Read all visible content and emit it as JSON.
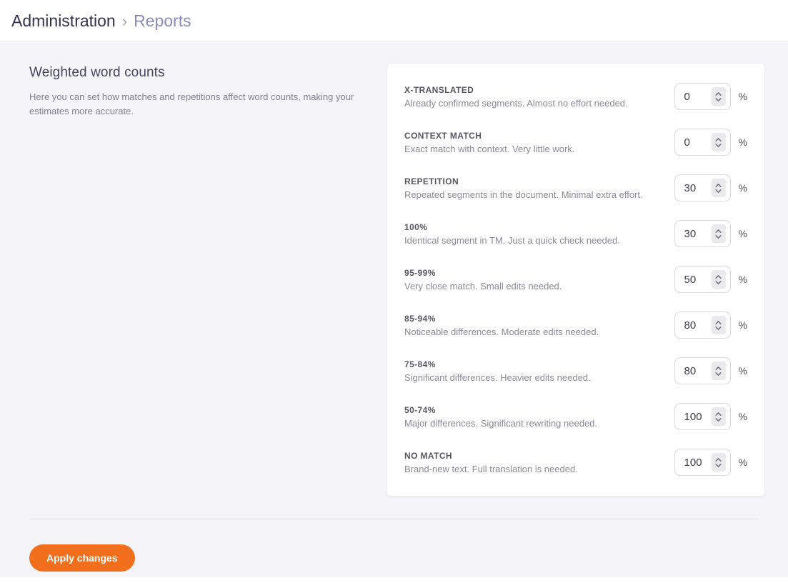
{
  "breadcrumb": {
    "section": "Administration",
    "separator": "›",
    "page": "Reports"
  },
  "intro": {
    "title": "Weighted word counts",
    "description": "Here you can set how matches and repetitions affect word counts, making your estimates more accurate."
  },
  "weights": {
    "rows": [
      {
        "label": "X-TRANSLATED",
        "description": "Already confirmed segments. Almost no effort needed.",
        "value": "0",
        "unit": "%"
      },
      {
        "label": "CONTEXT MATCH",
        "description": "Exact match with context. Very little work.",
        "value": "0",
        "unit": "%"
      },
      {
        "label": "REPETITION",
        "description": "Repeated segments in the document. Minimal extra effort.",
        "value": "30",
        "unit": "%"
      },
      {
        "label": "100%",
        "description": "Identical segment in TM. Just a quick check needed.",
        "value": "30",
        "unit": "%"
      },
      {
        "label": "95-99%",
        "description": "Very close match. Small edits needed.",
        "value": "50",
        "unit": "%"
      },
      {
        "label": "85-94%",
        "description": "Noticeable differences. Moderate edits needed.",
        "value": "80",
        "unit": "%"
      },
      {
        "label": "75-84%",
        "description": "Significant differences. Heavier edits needed.",
        "value": "80",
        "unit": "%"
      },
      {
        "label": "50-74%",
        "description": "Major differences. Significant rewriting needed.",
        "value": "100",
        "unit": "%"
      },
      {
        "label": "NO MATCH",
        "description": "Brand-new text. Full translation is needed.",
        "value": "100",
        "unit": "%"
      }
    ]
  },
  "footer": {
    "apply_button": "Apply changes"
  },
  "icons": {
    "stepper": "chevron-up-down-icon"
  },
  "colors": {
    "accent_orange": "#f2701d",
    "breadcrumb_link": "#8a8cbd",
    "page_background": "#f5f5f9"
  }
}
